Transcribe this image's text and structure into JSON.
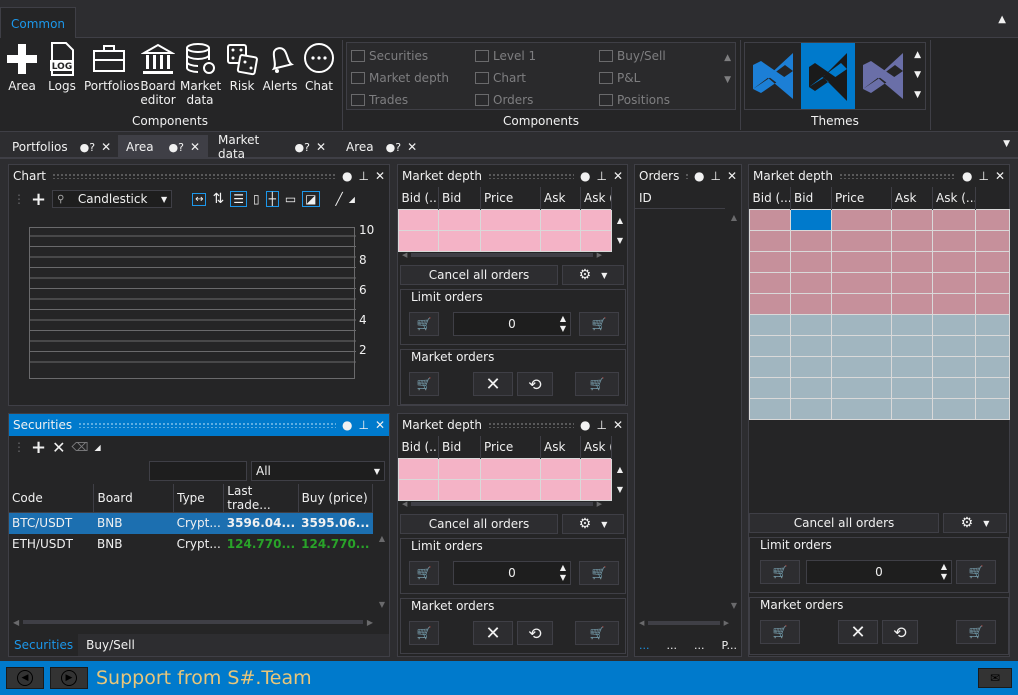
{
  "ribbon": {
    "tab": "Common",
    "components_buttons": [
      {
        "label": "Area",
        "icon": "plus-icon"
      },
      {
        "label": "Logs",
        "icon": "log-icon"
      },
      {
        "label": "Portfolios",
        "icon": "briefcase-icon"
      },
      {
        "label": "Board editor",
        "icon": "bank-icon"
      },
      {
        "label": "Market data",
        "icon": "database-icon"
      },
      {
        "label": "Risk",
        "icon": "dice-icon"
      },
      {
        "label": "Alerts",
        "icon": "bell-icon"
      },
      {
        "label": "Chat",
        "icon": "chat-icon"
      }
    ],
    "group1_label": "Components",
    "components2": [
      "Securities",
      "Level 1",
      "Buy/Sell",
      "Market depth",
      "Chart",
      "P&L",
      "Trades",
      "Orders",
      "Positions"
    ],
    "group2_label": "Components",
    "group3_label": "Themes"
  },
  "pane_tabs": [
    "Portfolios",
    "Area",
    "Market data",
    "Area"
  ],
  "chart": {
    "title": "Chart",
    "style_select": "Candlestick",
    "y_ticks": [
      "10",
      "8",
      "6",
      "4",
      "2"
    ]
  },
  "securities": {
    "title": "Securities",
    "filter_value": "",
    "filter_select": "All",
    "columns": [
      "Code",
      "Board",
      "Type",
      "Last trade...",
      "Buy (price)"
    ],
    "rows": [
      [
        "BTC/USDT",
        "BNB",
        "Crypt...",
        "3596.04...",
        "3595.06..."
      ],
      [
        "ETH/USDT",
        "BNB",
        "Crypt...",
        "124.770...",
        "124.770..."
      ]
    ],
    "bottom_tabs": [
      "Securities",
      "Buy/Sell"
    ]
  },
  "market_depth": {
    "title": "Market depth",
    "columns": [
      "Bid (...",
      "Bid",
      "Price",
      "Ask",
      "Ask ("
    ],
    "cancel_all": "Cancel all orders",
    "limit_orders": "Limit orders",
    "market_orders": "Market orders",
    "qty": "0"
  },
  "orders": {
    "title": "Orders",
    "column": "ID",
    "footer": "...",
    "footer_right": "P..."
  },
  "market_depth_big": {
    "title": "Market depth",
    "columns": [
      "Bid (...",
      "Bid",
      "Price",
      "Ask",
      "Ask (..."
    ]
  },
  "status": {
    "text": "Support from S#.Team"
  },
  "colors": {
    "accent": "#007acc",
    "bid": "#c6909b",
    "ask": "#a1b6c0",
    "pink": "#f4b3c6",
    "green": "#29a329"
  }
}
